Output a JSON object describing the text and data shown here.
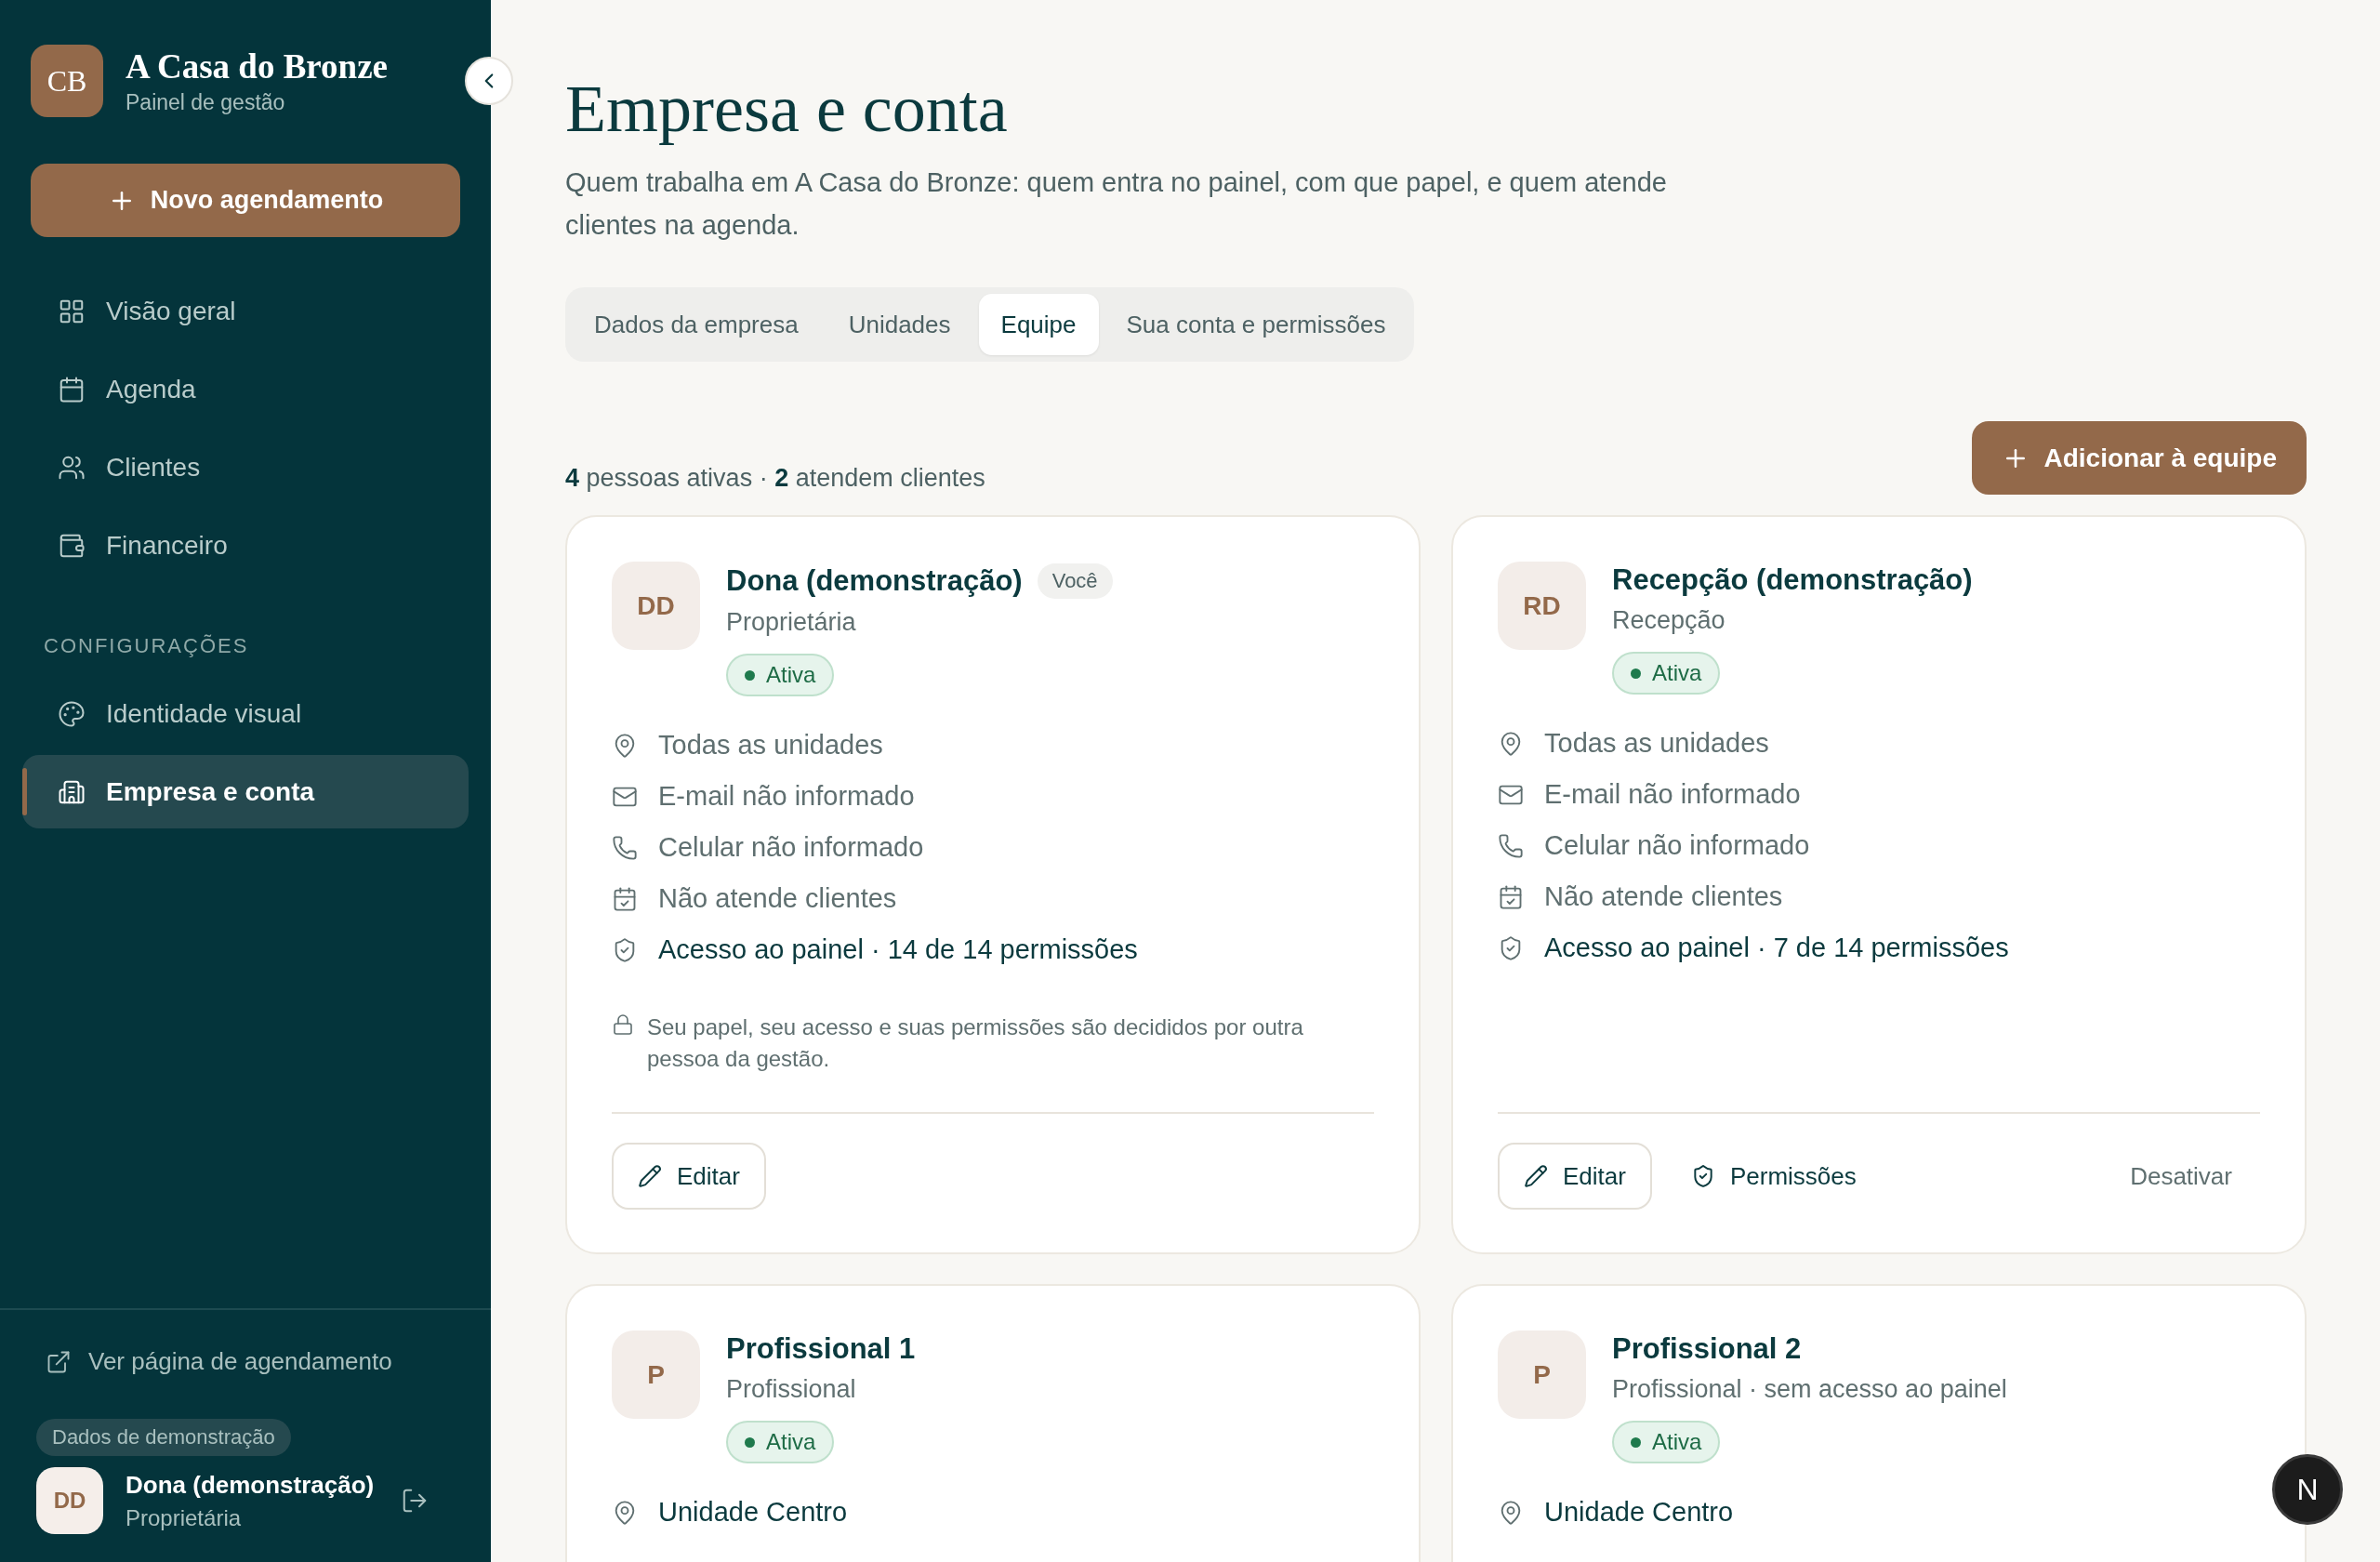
{
  "sidebar": {
    "brand": {
      "initials": "CB",
      "name": "A Casa do Bronze",
      "subtitle": "Painel de gestão"
    },
    "new_button": "Novo agendamento",
    "nav_items": [
      {
        "kind": "overview",
        "label": "Visão geral",
        "selected": false
      },
      {
        "kind": "agenda",
        "label": "Agenda",
        "selected": false
      },
      {
        "kind": "clients",
        "label": "Clientes",
        "selected": false
      },
      {
        "kind": "finance",
        "label": "Financeiro",
        "selected": false
      }
    ],
    "section_label": "CONFIGURAÇÕES",
    "settings_items": [
      {
        "kind": "palette",
        "label": "Identidade visual",
        "selected": false
      },
      {
        "kind": "company",
        "label": "Empresa e conta",
        "selected": true
      }
    ],
    "public_link": "Ver página de agendamento",
    "demo_badge": "Dados de demonstração",
    "user": {
      "initials": "DD",
      "name": "Dona (demonstração)",
      "role": "Proprietária"
    }
  },
  "main": {
    "title": "Empresa e conta",
    "description": "Quem trabalha em A Casa do Bronze: quem entra no painel, com que papel, e quem atende clientes na agenda.",
    "tabs": [
      {
        "label": "Dados da empresa",
        "selected": false
      },
      {
        "label": "Unidades",
        "selected": false
      },
      {
        "label": "Equipe",
        "selected": true
      },
      {
        "label": "Sua conta e permissões",
        "selected": false
      }
    ],
    "summary": "**4** pessoas ativas · **2** atendem clientes",
    "add_button": "Adicionar à equipe",
    "members": [
      {
        "initials": "DD",
        "name": "Dona (demonstração)",
        "tag": "Você",
        "role": "Proprietária",
        "status": "Ativa",
        "details": [
          {
            "kind": "location",
            "text": "Todas as unidades",
            "emphasis": false
          },
          {
            "kind": "email",
            "text": "E-mail não informado",
            "emphasis": false
          },
          {
            "kind": "phone",
            "text": "Celular não informado",
            "emphasis": false
          },
          {
            "kind": "schedule",
            "text": "Não atende clientes",
            "emphasis": false
          },
          {
            "kind": "access",
            "text": "Acesso ao painel · 14 de 14 permissões",
            "emphasis": true
          }
        ],
        "note": "Seu papel, seu acesso e suas permissões são decididos por outra pessoa da gestão.",
        "actions": [
          {
            "kind": "edit",
            "label": "Editar"
          }
        ]
      },
      {
        "initials": "RD",
        "name": "Recepção (demonstração)",
        "role": "Recepção",
        "status": "Ativa",
        "details": [
          {
            "kind": "location",
            "text": "Todas as unidades",
            "emphasis": false
          },
          {
            "kind": "email",
            "text": "E-mail não informado",
            "emphasis": false
          },
          {
            "kind": "phone",
            "text": "Celular não informado",
            "emphasis": false
          },
          {
            "kind": "schedule",
            "text": "Não atende clientes",
            "emphasis": false
          },
          {
            "kind": "access",
            "text": "Acesso ao painel · 7 de 14 permissões",
            "emphasis": true
          }
        ],
        "actions": [
          {
            "kind": "edit",
            "label": "Editar"
          },
          {
            "kind": "permissions",
            "label": "Permissões"
          },
          {
            "kind": "deactivate",
            "label": "Desativar"
          }
        ]
      },
      {
        "initials": "P",
        "name": "Profissional 1",
        "role": "Profissional",
        "status": "Ativa",
        "details": [
          {
            "kind": "location",
            "text": "Unidade Centro",
            "emphasis": true
          }
        ]
      },
      {
        "initials": "P",
        "name": "Profissional 2",
        "role": "Profissional · sem acesso ao painel",
        "status": "Ativa",
        "details": [
          {
            "kind": "location",
            "text": "Unidade Centro",
            "emphasis": true
          }
        ]
      }
    ]
  },
  "dev_badge": "N"
}
